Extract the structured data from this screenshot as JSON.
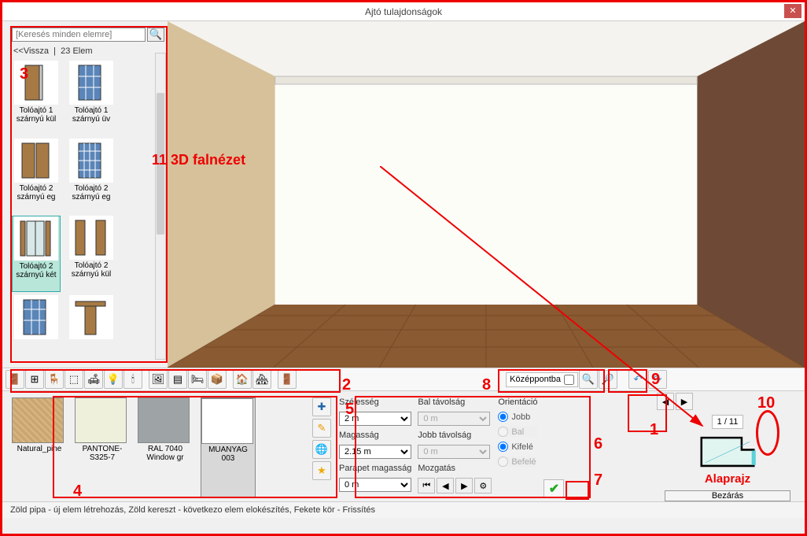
{
  "window": {
    "title": "Ajtó tulajdonságok"
  },
  "search": {
    "placeholder": "[Keresés minden elemre]"
  },
  "back": {
    "label": "<<Vissza",
    "count": "23 Elem"
  },
  "doors": {
    "items": [
      {
        "label": "Tolóajtó 1 szárnyú kül"
      },
      {
        "label": "Tolóajtó 1 szárnyú üv"
      },
      {
        "label": "Tolóajtó 2 szárnyú eg"
      },
      {
        "label": "Tolóajtó 2 szárnyú eg"
      },
      {
        "label": "Tolóajtó 2 szárnyú két"
      },
      {
        "label": "Tolóajtó 2 szárnyú kül"
      },
      {
        "label": ""
      },
      {
        "label": ""
      }
    ]
  },
  "annotations": {
    "wallview": "11 3D falnézet",
    "alaprajz": "Alaprajz",
    "n1": "1",
    "n2": "2",
    "n3": "3",
    "n4": "4",
    "n5": "5",
    "n6": "6",
    "n7": "7",
    "n8": "8",
    "n9": "9",
    "n10": "10"
  },
  "toolbar": {
    "centerLabel": "Középpontba"
  },
  "materials": {
    "items": [
      {
        "label": "Natural_pine",
        "color": "#d6b480"
      },
      {
        "label": "PANTONE-S325-7",
        "color": "#eef0dc"
      },
      {
        "label": "RAL 7040 Window gr",
        "color": "#9ea3a6"
      },
      {
        "label": "MUANYAG 003",
        "color": "#ffffff"
      }
    ]
  },
  "params": {
    "widthLabel": "Szélesség",
    "width": "2 m",
    "heightLabel": "Magasság",
    "height": "2.15 m",
    "parapetLabel": "Parapet magasság",
    "parapet": "0 m",
    "leftDistLabel": "Bal távolság",
    "leftDist": "0 m",
    "rightDistLabel": "Jobb távolság",
    "rightDist": "0 m",
    "motionLabel": "Mozgatás",
    "orientLabel": "Orientáció",
    "orientRight": "Jobb",
    "orientLeft": "Bal",
    "orientOut": "Kifelé",
    "orientIn": "Befelé"
  },
  "wallnav": {
    "count": "1 / 11"
  },
  "close": {
    "label": "Bezárás"
  },
  "status": {
    "text": "Zöld pipa - új elem létrehozás, Zöld kereszt - következo elem elokészítés, Fekete kör - Frissítés"
  }
}
